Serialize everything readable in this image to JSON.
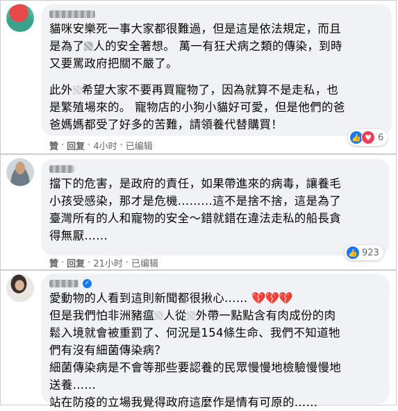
{
  "comments": [
    {
      "author": "Jam Jam",
      "paragraphs": [
        [
          "貓咪安樂死一事大家都很難過，但是這是依法規定，而且",
          "是為了",
          "人的安全著想。 萬一有狂犬病之類的傳染，到時",
          "又要罵政府把關不嚴了。"
        ],
        [
          "此外",
          "希望大家不要再買寵物了，因為就算不是走私，也",
          "是繁殖場來的。 寵物店的小狗小貓好可愛，但是他們的爸",
          "爸媽媽都受了好多的苦難，請領養代替購買！"
        ]
      ],
      "actions": {
        "like": "贊",
        "reply": "回复",
        "time": "4小时",
        "edited": "已编辑"
      },
      "reaction_count": "6"
    },
    {
      "author": "",
      "lines": [
        "擋下的危害，是政府的責任，如果帶進來的病毒，讓養毛",
        "小孩受感染，那才是危機………這不是捨不捨，這是為了",
        "臺灣所有的人和寵物的安全～錯就錯在違法走私的船長貪",
        "得無厭……"
      ],
      "actions": {
        "like": "贊",
        "reply": "回复",
        "time": "21小时",
        "edited": "已编辑"
      },
      "reaction_count": "923"
    },
    {
      "author": "",
      "line1": "愛動物的人看到這則新聞都很揪心……",
      "hearts": "💔💔💔",
      "line2a": "但是我們怕非洲豬瘟",
      "line2b": "人從",
      "line2c": "外帶一點點含有肉成份的肉",
      "lines_rest": [
        "鬆入境就會被重罰了、何況是154條生命、我們不知道牠",
        "們有沒有細菌傳染病？",
        "細菌傳染病是不會等那些要認養的民眾慢慢地檢驗慢慢地",
        "送養……",
        "站在防疫的立場我覺得政府這麼作是情有可原的……"
      ]
    }
  ],
  "icons": {
    "like": "thumbs-up-icon",
    "love": "heart-icon",
    "verified": "verified-badge-icon"
  },
  "colors": {
    "like_blue": "#1877f2",
    "love_red": "#f33e58",
    "bubble_bg": "#f0f2f5",
    "meta_gray": "#65676b"
  }
}
